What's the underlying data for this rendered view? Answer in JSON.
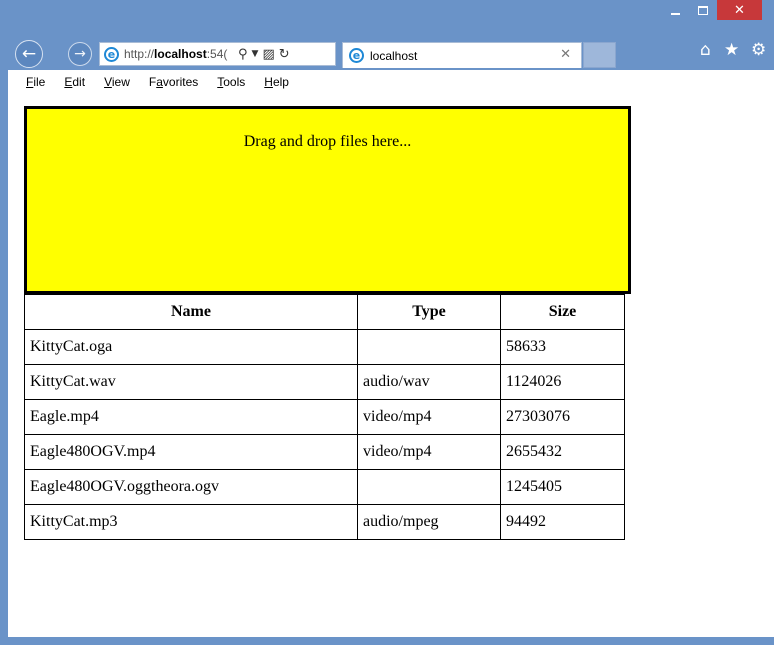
{
  "browser": {
    "address": {
      "prefix": "http://",
      "host": "localhost",
      "rest": ":54("
    },
    "tab": {
      "title": "localhost"
    }
  },
  "menu": [
    "File",
    "Edit",
    "View",
    "Favorites",
    "Tools",
    "Help"
  ],
  "menu_accel": [
    "F",
    "E",
    "V",
    "a",
    "T",
    "H"
  ],
  "dropzone": {
    "text": "Drag and drop files here..."
  },
  "table": {
    "headers": [
      "Name",
      "Type",
      "Size"
    ],
    "rows": [
      {
        "name": "KittyCat.oga",
        "type": "",
        "size": "58633"
      },
      {
        "name": "KittyCat.wav",
        "type": "audio/wav",
        "size": "1124026"
      },
      {
        "name": "Eagle.mp4",
        "type": "video/mp4",
        "size": "27303076"
      },
      {
        "name": "Eagle480OGV.mp4",
        "type": "video/mp4",
        "size": "2655432"
      },
      {
        "name": "Eagle480OGV.oggtheora.ogv",
        "type": "",
        "size": "1245405"
      },
      {
        "name": "KittyCat.mp3",
        "type": "audio/mpeg",
        "size": "94492"
      }
    ]
  },
  "colors": {
    "frame": "#6a93c8",
    "dropzone": "#ffff00",
    "close": "#c7383a"
  },
  "icons": [
    "back-arrow-icon",
    "forward-arrow-icon",
    "ie-logo-icon",
    "search-icon",
    "compat-view-icon",
    "refresh-icon",
    "home-icon",
    "star-icon",
    "gear-icon"
  ]
}
